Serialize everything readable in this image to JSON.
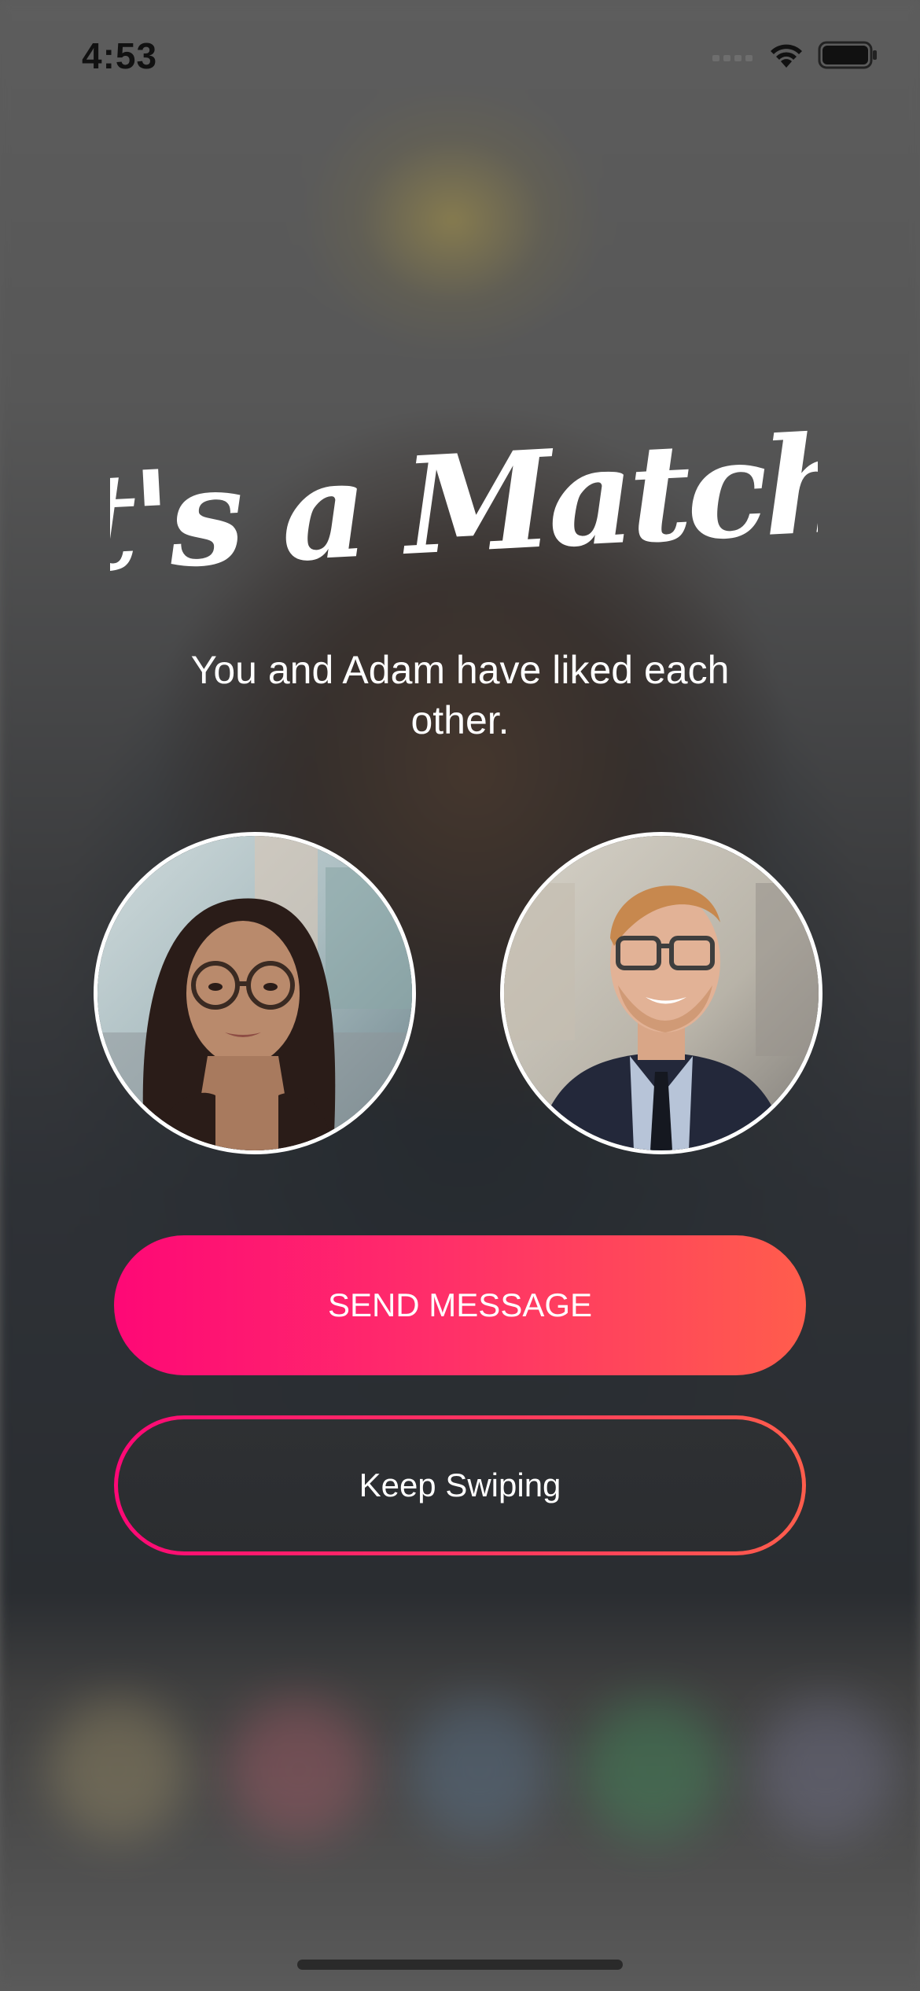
{
  "status_bar": {
    "time": "4:53",
    "icons": [
      "cellular-signal-icon",
      "wifi-icon",
      "battery-icon"
    ]
  },
  "match": {
    "title": "It's a Match!",
    "subtitle": "You and Adam have liked each other.",
    "left_avatar_name": "woman-with-glasses-photo",
    "right_avatar_name": "adam-profile-photo"
  },
  "actions": {
    "send_message": "SEND MESSAGE",
    "keep_swiping": "Keep Swiping"
  },
  "colors": {
    "gradient_start": "#fe0876",
    "gradient_end": "#ff5d4c",
    "overlay": "#2c2e31"
  }
}
